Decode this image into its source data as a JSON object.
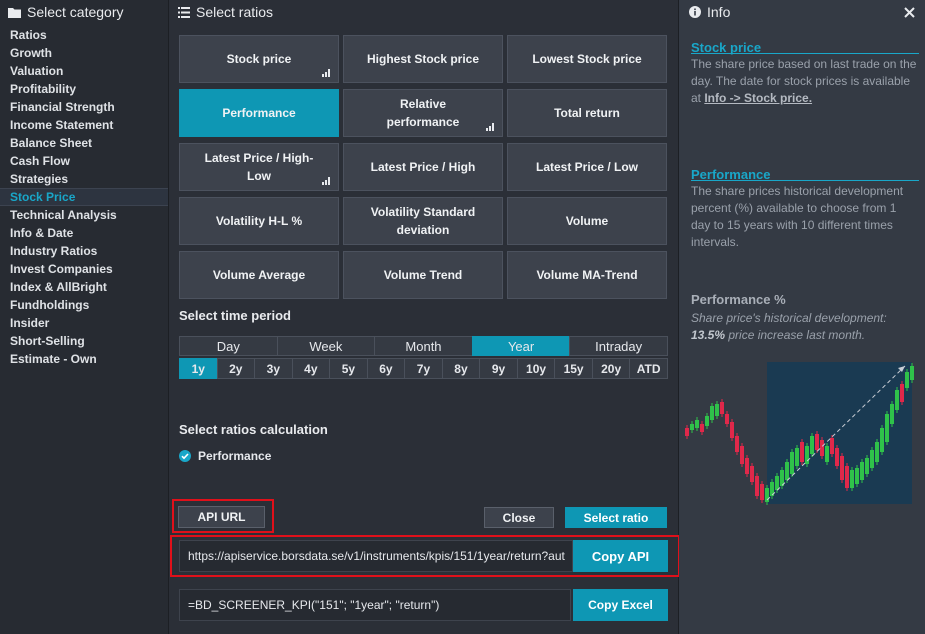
{
  "left": {
    "title": "Select category",
    "categories": [
      {
        "label": "Ratios"
      },
      {
        "label": "Growth"
      },
      {
        "label": "Valuation"
      },
      {
        "label": "Profitability"
      },
      {
        "label": "Financial Strength"
      },
      {
        "label": "Income Statement"
      },
      {
        "label": "Balance Sheet"
      },
      {
        "label": "Cash Flow"
      },
      {
        "label": "Strategies"
      },
      {
        "label": "Stock Price",
        "active": true
      },
      {
        "label": "Technical Analysis"
      },
      {
        "label": "Info & Date"
      },
      {
        "label": "Industry Ratios"
      },
      {
        "label": "Invest Companies"
      },
      {
        "label": "Index & AllBright"
      },
      {
        "label": "Fundholdings"
      },
      {
        "label": "Insider"
      },
      {
        "label": "Short-Selling"
      },
      {
        "label": "Estimate - Own"
      }
    ]
  },
  "mid": {
    "title": "Select ratios",
    "ratios": [
      {
        "label": "Stock price",
        "chart": true
      },
      {
        "label": "Highest Stock price"
      },
      {
        "label": "Lowest Stock price"
      },
      {
        "label": "Performance",
        "active": true
      },
      {
        "label": "Relative performance",
        "chart": true
      },
      {
        "label": "Total return"
      },
      {
        "label": "Latest Price / High-Low",
        "chart": true
      },
      {
        "label": "Latest Price / High"
      },
      {
        "label": "Latest Price / Low"
      },
      {
        "label": "Volatility H-L %"
      },
      {
        "label": "Volatility Standard deviation"
      },
      {
        "label": "Volume"
      },
      {
        "label": "Volume Average"
      },
      {
        "label": "Volume Trend"
      },
      {
        "label": "Volume MA-Trend"
      }
    ],
    "time_title": "Select time period",
    "period_tabs": [
      "Day",
      "Week",
      "Month",
      "Year",
      "Intraday"
    ],
    "period_active": "Year",
    "years": [
      "1y",
      "2y",
      "3y",
      "4y",
      "5y",
      "6y",
      "7y",
      "8y",
      "9y",
      "10y",
      "15y",
      "20y",
      "ATD"
    ],
    "year_active": "1y",
    "calc_title": "Select ratios calculation",
    "calc_option": "Performance",
    "api_url_label": "API URL",
    "close_label": "Close",
    "select_label": "Select ratio",
    "api_url_value": "https://apiservice.borsdata.se/v1/instruments/kpis/151/1year/return?aut",
    "copy_api_label": "Copy API",
    "excel_formula": "=BD_SCREENER_KPI(\"151\"; \"1year\"; \"return\")",
    "copy_excel_label": "Copy Excel"
  },
  "info": {
    "title": "Info",
    "stock_price_heading": "Stock price",
    "stock_price_text": "The share price based on last trade on the day. The date for stock prices is available at ",
    "stock_price_link": "Info -> Stock price.",
    "performance_heading": "Performance",
    "performance_text": "The share prices historical development percent (%) available to choose from 1 day to 15 years with 10 different times intervals.",
    "perf_pct_heading": "Performance %",
    "perf_pct_text1": "Share price's historical development:",
    "perf_pct_value": "13.5%",
    "perf_pct_text2": " price increase last month."
  },
  "colors": {
    "accent": "#0e97b4",
    "candle_up": "#2fc24a",
    "candle_down": "#e0284a",
    "highlight_box": "#e0101a"
  },
  "icons": {
    "folder": "folder-icon",
    "list": "list-icon",
    "info": "info-icon",
    "close": "close-icon"
  }
}
